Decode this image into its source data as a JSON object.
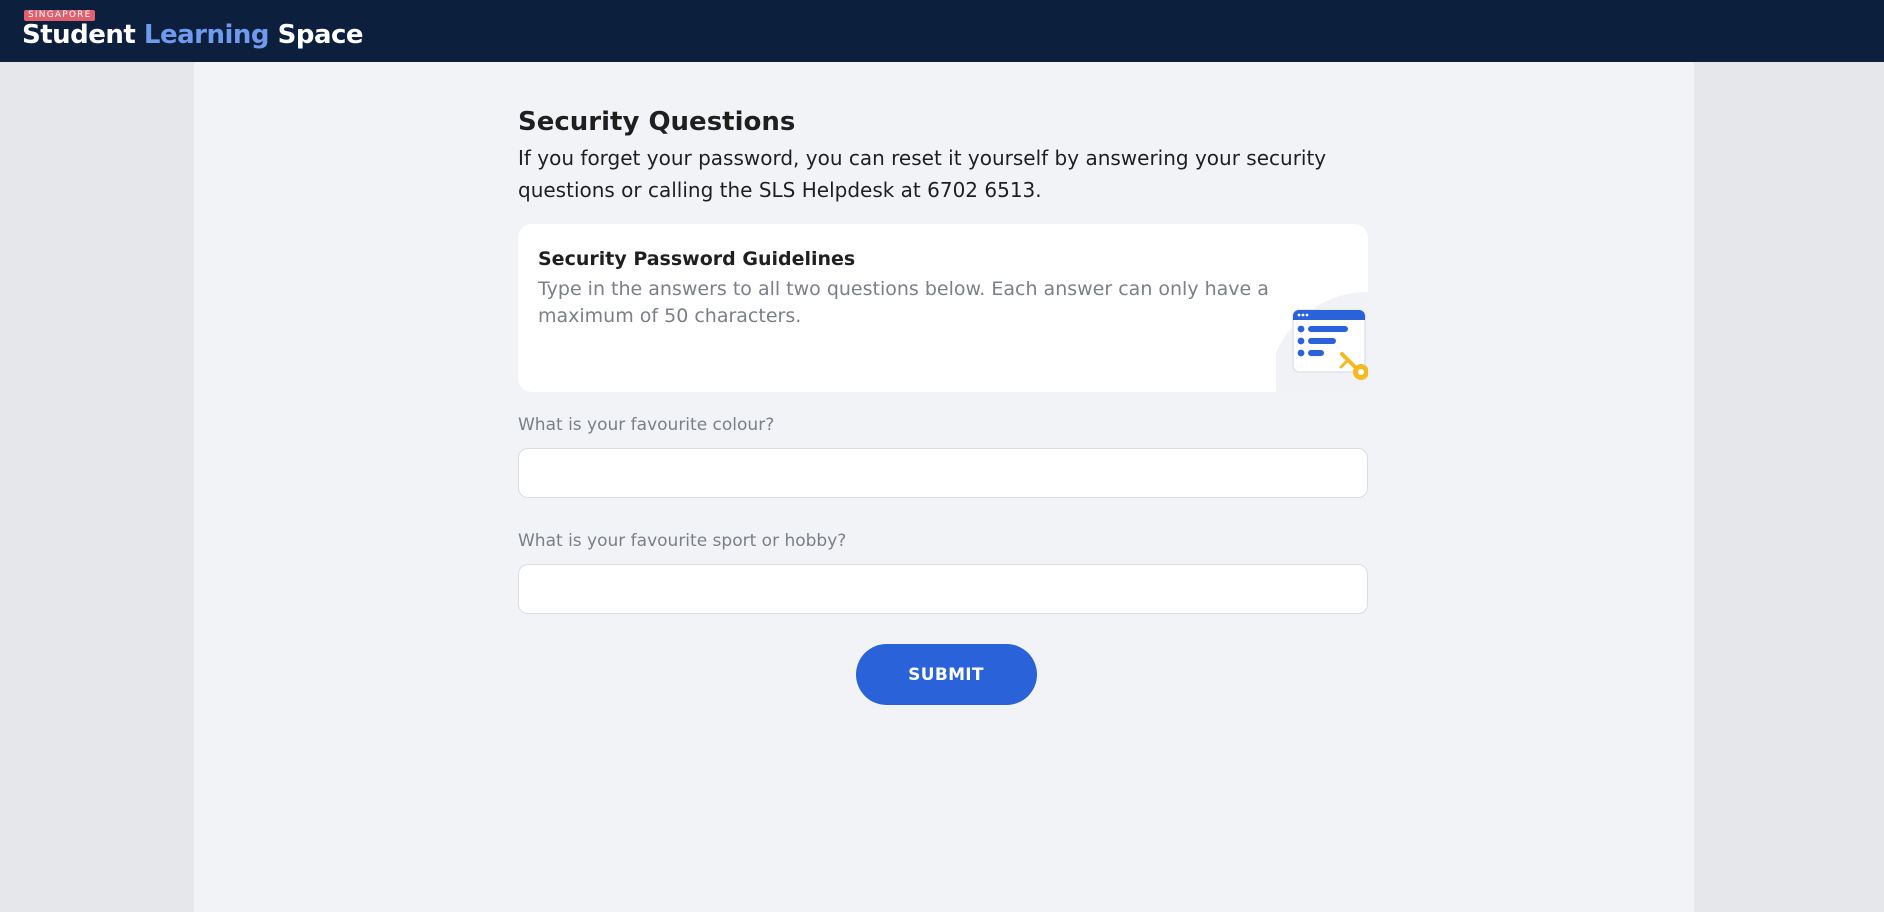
{
  "header": {
    "logo": {
      "badge": "SINGAPORE",
      "word1": "Student",
      "word2": "Learning",
      "word3": "Space"
    }
  },
  "main": {
    "title": "Security Questions",
    "intro": "If you forget your password, you can reset it yourself by answering your security questions or calling the SLS Helpdesk at 6702 6513.",
    "guidelines": {
      "title": "Security Password Guidelines",
      "text": "Type in the answers to all two questions below. Each answer can only have a maximum of 50 characters.",
      "illustration_icon": "form-key-illustration-icon"
    },
    "questions": [
      {
        "label": "What is your favourite colour?",
        "value": ""
      },
      {
        "label": "What is your favourite sport or hobby?",
        "value": ""
      }
    ],
    "submit_label": "SUBMIT"
  },
  "colors": {
    "header_bg": "#0c1f3d",
    "accent": "#2962d9",
    "logo_highlight": "#6f9aee",
    "badge": "#e0606d",
    "key": "#f5b921"
  }
}
